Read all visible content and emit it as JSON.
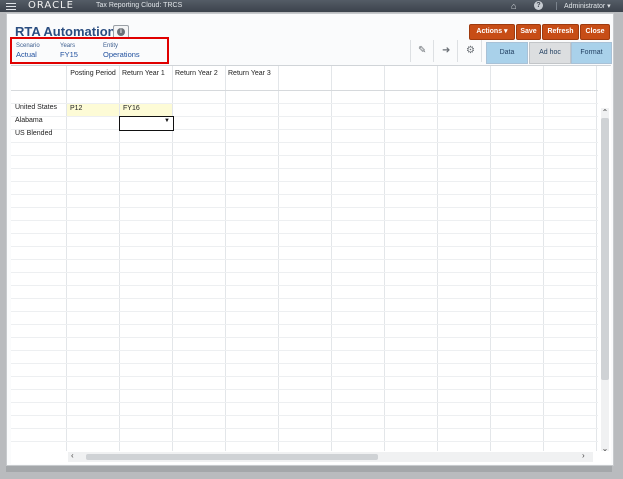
{
  "topbar": {
    "menu_icon": "hamburger-icon",
    "logo": "ORACLE",
    "product": "Tax Reporting Cloud: TRCS",
    "home_icon": "home-icon",
    "help_icon": "help-icon",
    "user": "Administrator ▾"
  },
  "page": {
    "title": "RTA Automation",
    "info_icon": "info-icon"
  },
  "buttons": {
    "actions": "Actions ▾",
    "save": "Save",
    "refresh": "Refresh",
    "close": "Close"
  },
  "pov": [
    {
      "label": "Scenario",
      "value": "Actual"
    },
    {
      "label": "Years",
      "value": "FY15"
    },
    {
      "label": "Entity",
      "value": "Operations"
    }
  ],
  "toolbar": {
    "edit_icon": "pencil-icon",
    "go_icon": "arrow-right-icon",
    "settings_icon": "gear-icon",
    "data_tab": "Data",
    "adhoc_tab": "Ad hoc",
    "format_tab": "Format"
  },
  "grid": {
    "columns": [
      "Posting Period",
      "Return Year 1",
      "Return Year 2",
      "Return Year 3"
    ],
    "rows": [
      "United States",
      "Alabama",
      "US Blended"
    ],
    "cells": {
      "us_posting_period": "P12",
      "us_return_year_1": "FY16"
    },
    "dropdown_icon": "caret-down-icon"
  },
  "colors": {
    "accent_button": "#c74d16",
    "title": "#2a4d80",
    "pov_highlight": "#e00000",
    "tab_active": "#a9d1ea"
  }
}
